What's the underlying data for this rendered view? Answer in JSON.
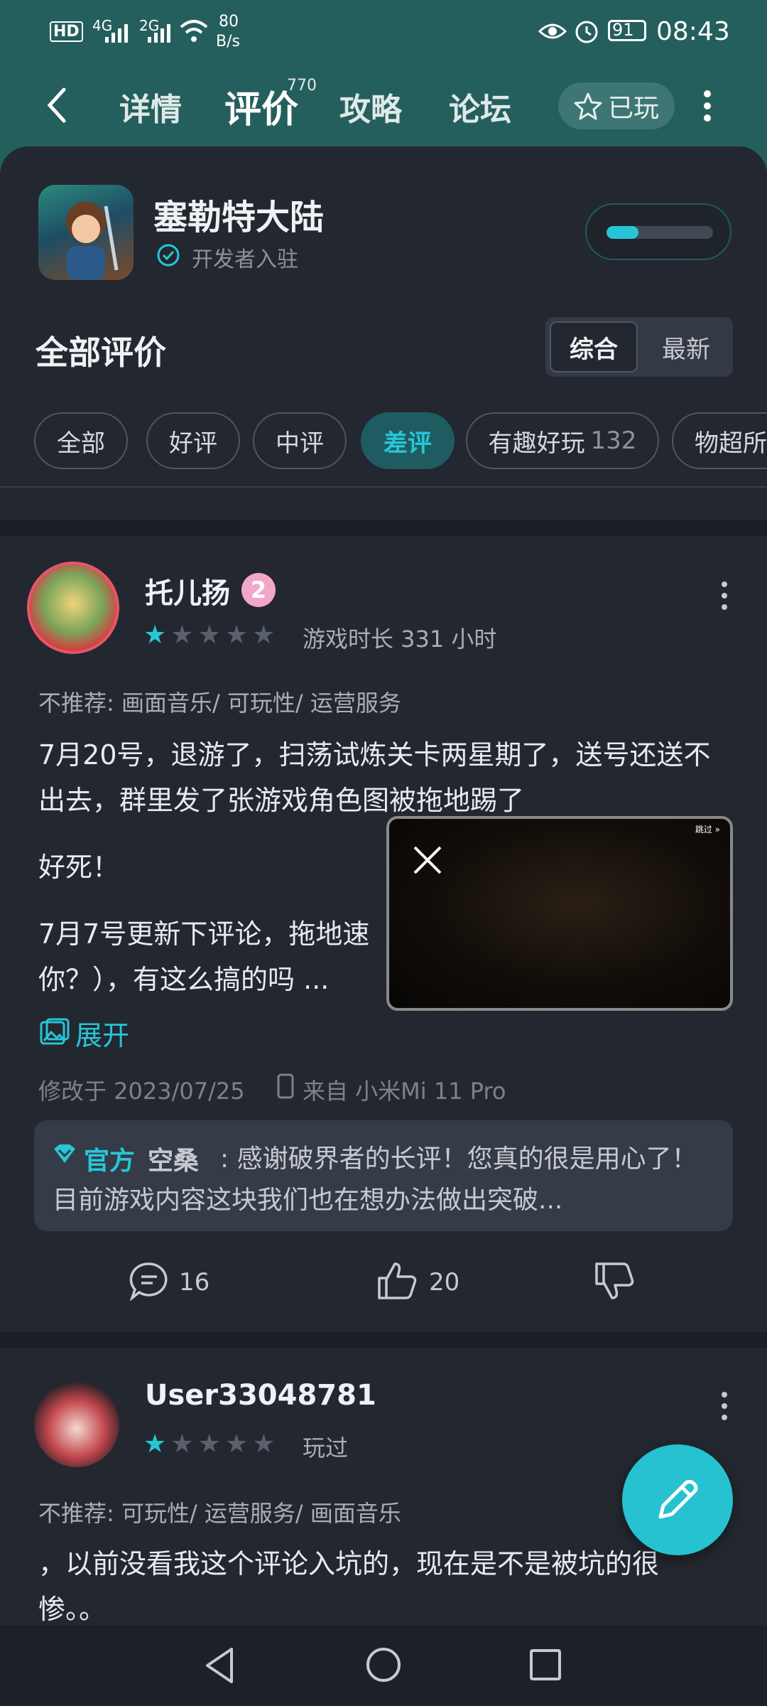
{
  "status_bar": {
    "left": {
      "hd": "HD",
      "sig1": "4G",
      "sig2": "2G",
      "net_speed": "80",
      "net_unit": "B/s"
    },
    "battery": "91",
    "time": "08:43"
  },
  "nav": {
    "tabs": [
      {
        "label": "详情"
      },
      {
        "label": "评价",
        "badge": "770"
      },
      {
        "label": "攻略"
      },
      {
        "label": "论坛"
      }
    ],
    "played_label": "已玩"
  },
  "game": {
    "title": "塞勒特大陆",
    "verified_label": "开发者入驻",
    "progress": 0.3
  },
  "reviews_header": {
    "title": "全部评价",
    "sort": [
      "综合",
      "最新"
    ]
  },
  "filters": [
    {
      "label": "全部"
    },
    {
      "label": "好评"
    },
    {
      "label": "中评"
    },
    {
      "label": "差评"
    },
    {
      "label": "有趣好玩",
      "count": "132"
    },
    {
      "label": "物超所"
    }
  ],
  "review1": {
    "username": "托儿扬",
    "level": "2",
    "rating": 1,
    "playtime": "游戏时长 331 小时",
    "tags": "不推荐: 画面音乐/ 可玩性/ 运营服务",
    "p1": "7月20号，退游了，扫荡试炼关卡两星期了，送号还送不出去，群里发了张游戏角色图被拖地踢了",
    "p2": "好死！",
    "p3a": "7月7号更新下评论，拖地速",
    "p3b": "你？），有这么搞的吗 ...",
    "expand": "展开",
    "modified": "修改于 2023/07/25",
    "device": "来自 小米Mi 11 Pro",
    "official_tag": "官方",
    "official_name": "空桑",
    "official_reply": "感谢破界者的长评！您真的很是用心了！目前游戏内容这块我们也在想办法做出突破...",
    "comments": "16",
    "likes": "20"
  },
  "review2": {
    "username": "User33048781",
    "rating": 1,
    "played": "玩过",
    "tags": "不推荐: 可玩性/ 运营服务/ 画面音乐",
    "p1a": "，以前没看我这个评论入坑的，现在是不是被坑的很",
    "p1b": "惨。。"
  },
  "floating_video": {
    "badge": "跳过 »"
  }
}
